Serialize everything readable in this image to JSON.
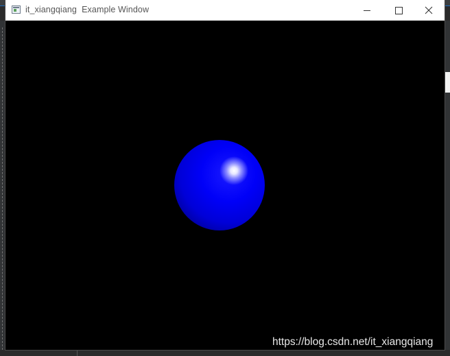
{
  "window": {
    "title": "it_xiangqiang  Example Window",
    "controls": {
      "minimize_icon": "minimize-icon",
      "maximize_icon": "maximize-icon",
      "close_icon": "close-icon"
    }
  },
  "scene": {
    "background_color": "#000000",
    "object": "sphere",
    "object_color": "#0000ff",
    "highlight_color": "#ffffff"
  },
  "watermark": {
    "text": "https://blog.csdn.net/it_xiangqiang"
  }
}
